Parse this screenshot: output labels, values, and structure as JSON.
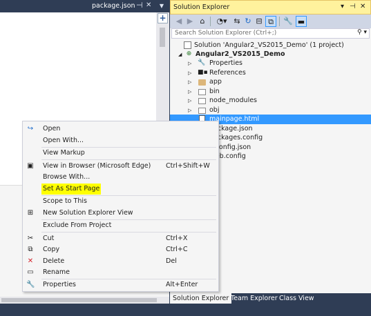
{
  "editor": {
    "tab_label": "package.json"
  },
  "explorer": {
    "title": "Solution Explorer",
    "search_placeholder": "Search Solution Explorer (Ctrl+;)",
    "tree": [
      {
        "label": "Solution 'Angular2_VS2015_Demo' (1 project)",
        "bold": false,
        "selected": false,
        "icon": "solution-icon"
      },
      {
        "label": "Angular2_VS2015_Demo",
        "bold": true,
        "selected": false,
        "icon": "web-project-icon"
      },
      {
        "label": "Properties",
        "bold": false,
        "selected": false,
        "icon": "wrench-icon"
      },
      {
        "label": "References",
        "bold": false,
        "selected": false,
        "icon": "references-icon"
      },
      {
        "label": "app",
        "bold": false,
        "selected": false,
        "icon": "folder-icon"
      },
      {
        "label": "bin",
        "bold": false,
        "selected": false,
        "icon": "folder-icon"
      },
      {
        "label": "node_modules",
        "bold": false,
        "selected": false,
        "icon": "folder-icon"
      },
      {
        "label": "obj",
        "bold": false,
        "selected": false,
        "icon": "folder-icon"
      },
      {
        "label": "mainpage.html",
        "bold": false,
        "selected": true,
        "icon": "html-file-icon"
      },
      {
        "label": "package.json",
        "bold": false,
        "selected": false,
        "icon": "json-file-icon"
      },
      {
        "label": "packages.config",
        "bold": false,
        "selected": false,
        "icon": "config-file-icon"
      },
      {
        "label": "tsconfig.json",
        "bold": false,
        "selected": false,
        "icon": "json-file-icon"
      },
      {
        "label": "Web.config",
        "bold": false,
        "selected": false,
        "icon": "config-file-icon"
      }
    ],
    "tabs": [
      "Solution Explorer",
      "Team Explorer",
      "Class View"
    ]
  },
  "context_menu": {
    "items": [
      {
        "label": "Open",
        "shortcut": "",
        "icon": "open-arrow-icon"
      },
      {
        "label": "Open With...",
        "shortcut": "",
        "icon": ""
      },
      {
        "label": "View Markup",
        "shortcut": "",
        "icon": ""
      },
      {
        "label": "View in Browser (Microsoft Edge)",
        "shortcut": "Ctrl+Shift+W",
        "icon": "browser-icon"
      },
      {
        "label": "Browse With...",
        "shortcut": "",
        "icon": ""
      },
      {
        "label": "Set As Start Page",
        "shortcut": "",
        "icon": "",
        "highlight": "#ffff00"
      },
      {
        "label": "Scope to This",
        "shortcut": "",
        "icon": ""
      },
      {
        "label": "New Solution Explorer View",
        "shortcut": "",
        "icon": "new-view-icon"
      },
      {
        "label": "Exclude From Project",
        "shortcut": "",
        "icon": ""
      },
      {
        "label": "Cut",
        "shortcut": "Ctrl+X",
        "icon": "scissors-icon"
      },
      {
        "label": "Copy",
        "shortcut": "Ctrl+C",
        "icon": "copy-icon"
      },
      {
        "label": "Delete",
        "shortcut": "Del",
        "icon": "delete-x-icon"
      },
      {
        "label": "Rename",
        "shortcut": "",
        "icon": "rename-icon"
      },
      {
        "label": "Properties",
        "shortcut": "Alt+Enter",
        "icon": "wrench-icon"
      }
    ]
  },
  "colors": {
    "chrome": "#2f3d55",
    "title_active": "#fff29d",
    "selection": "#3399ff",
    "highlight": "#ffff00"
  }
}
